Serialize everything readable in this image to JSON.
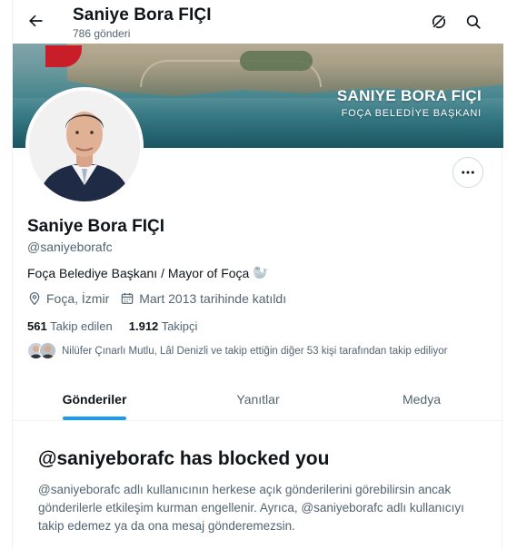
{
  "header": {
    "title": "Saniye Bora FIÇI",
    "subtitle": "786 gönderi"
  },
  "banner": {
    "name": "SANIYE BORA FIÇI",
    "role": "FOÇA BELEDİYE BAŞKANI"
  },
  "profile": {
    "name": "Saniye Bora FIÇI",
    "handle": "@saniyeborafc",
    "bio": "Foça Belediye Başkanı / Mayor of Foça",
    "bio_emoji": "🦭",
    "location": "Foça, İzmir",
    "joined": "Mart 2013 tarihinde katıldı",
    "following_count": "561",
    "following_label": "Takip edilen",
    "followers_count": "1.912",
    "followers_label": "Takipçi",
    "followed_by": "Nilüfer Çınarlı Mutlu, Lâl Denizli ve takip ettiğin diğer 53 kişi tarafından takip ediliyor"
  },
  "tabs": [
    {
      "label": "Gönderiler",
      "active": true
    },
    {
      "label": "Yanıtlar",
      "active": false
    },
    {
      "label": "Medya",
      "active": false
    }
  ],
  "blocked": {
    "title": "@saniyeborafc has blocked you",
    "text": "@saniyeborafc adlı kullanıcının herkese açık gönderilerini görebilirsin ancak gönderilerle etkileşim kurman engellenir. Ayrıca, @saniyeborafc adlı kullanıcıyı takip edemez ya da ona mesaj gönderemezsin."
  },
  "colors": {
    "accent": "#1d9bf0",
    "text_primary": "#0f1419",
    "text_secondary": "#536471"
  },
  "icons": [
    "back-arrow-icon",
    "grok-icon",
    "search-icon",
    "more-icon",
    "location-icon",
    "calendar-icon"
  ]
}
